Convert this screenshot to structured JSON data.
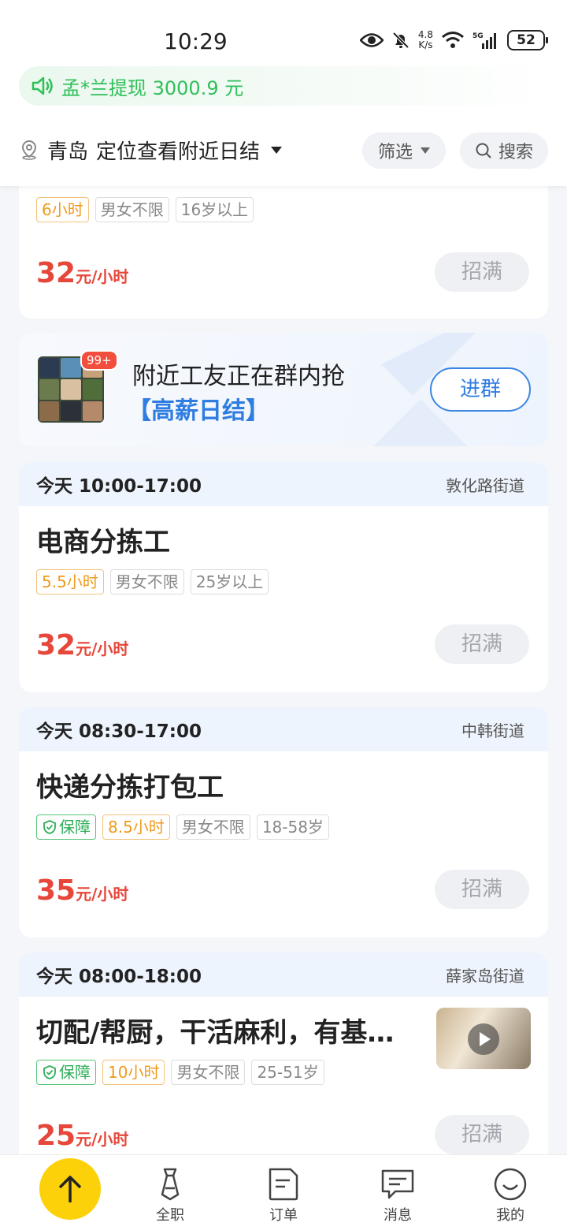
{
  "status_bar": {
    "time": "10:29",
    "speed_value": "4.8",
    "speed_unit": "K/s",
    "battery": "52"
  },
  "ticker": {
    "text": "孟*兰提现 3000.9 元",
    "color": "#2fbf59"
  },
  "location": {
    "city": "青岛",
    "hint": "定位查看附近日结"
  },
  "filter_label": "筛选",
  "search_label": "搜索",
  "partial_card": {
    "tags": [
      "6小时",
      "男女不限",
      "16岁以上"
    ],
    "price_num": "32",
    "price_unit": "元/小时",
    "status": "招满"
  },
  "group": {
    "badge": "99+",
    "line1": "附近工友正在群内抢",
    "line2": "【高薪日结】",
    "button": "进群"
  },
  "jobs": [
    {
      "time": "今天 10:00-17:00",
      "area": "敦化路街道",
      "title": "电商分拣工",
      "guarantee": "",
      "hours": "5.5小时",
      "gender": "男女不限",
      "age": "25岁以上",
      "price_num": "32",
      "price_unit": "元/小时",
      "status": "招满"
    },
    {
      "time": "今天 08:30-17:00",
      "area": "中韩街道",
      "title": "快递分拣打包工",
      "guarantee": "保障",
      "hours": "8.5小时",
      "gender": "男女不限",
      "age": "18-58岁",
      "price_num": "35",
      "price_unit": "元/小时",
      "status": "招满"
    },
    {
      "time": "今天 08:00-18:00",
      "area": "薛家岛街道",
      "title": "切配/帮厨，干活麻利，有基…",
      "guarantee": "保障",
      "hours": "10小时",
      "gender": "男女不限",
      "age": "25-51岁",
      "price_num": "25",
      "price_unit": "元/小时",
      "status": "招满"
    }
  ],
  "nav": {
    "fulltime": "全职",
    "orders": "订单",
    "messages": "消息",
    "mine": "我的"
  },
  "colors": {
    "accent_blue": "#2f7de1",
    "price_red": "#e6473a",
    "fab_yellow": "#fcd10a"
  }
}
